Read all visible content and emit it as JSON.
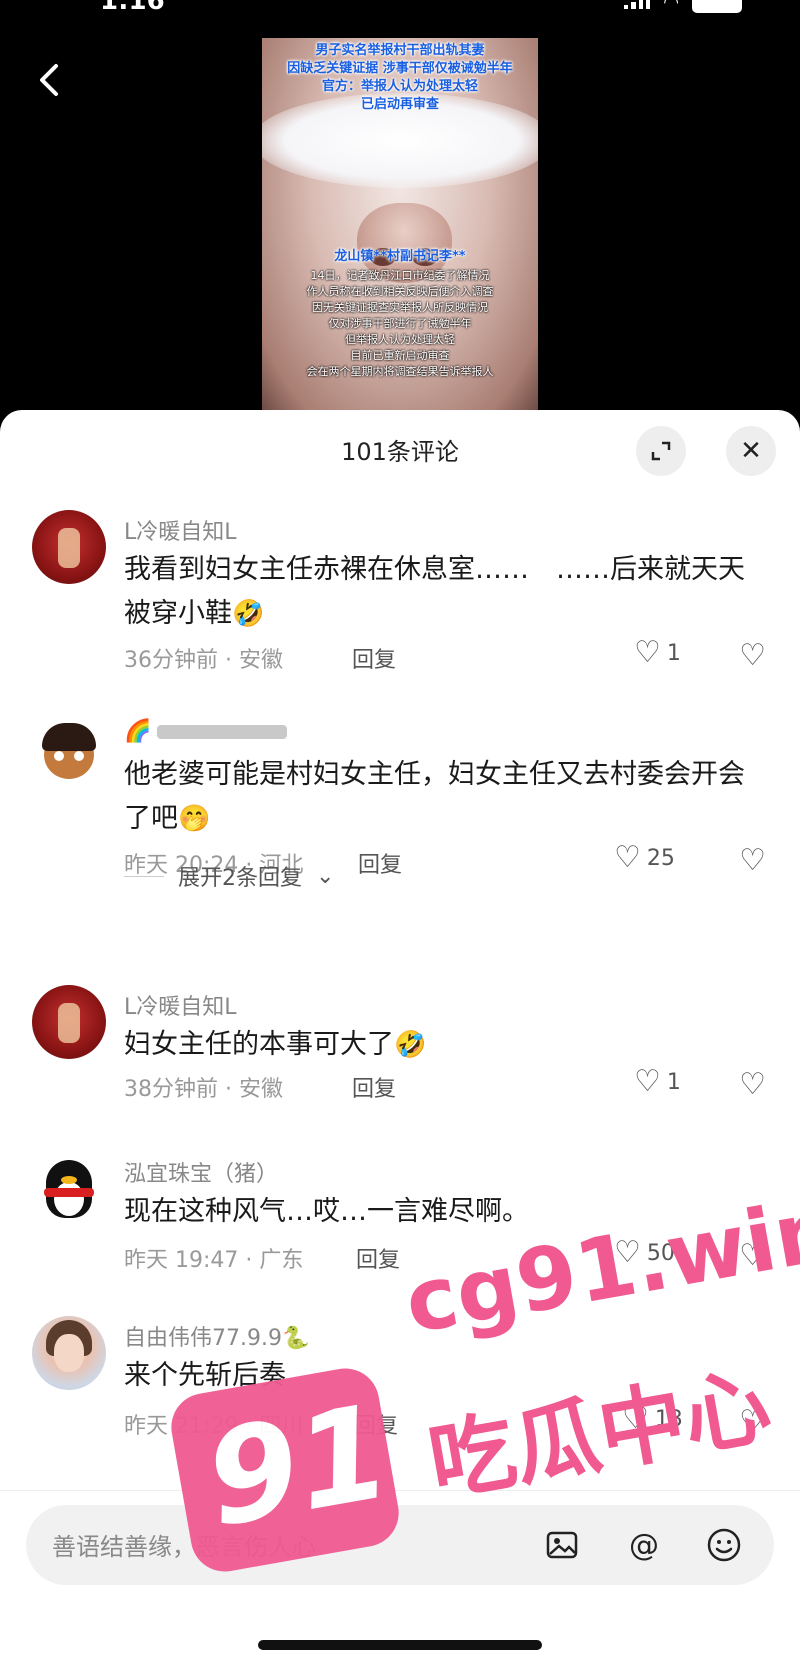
{
  "status": {
    "time": "1:16"
  },
  "video": {
    "caption_lines": [
      "男子实名举报村干部出轨其妻",
      "因缺乏关键证据 涉事干部仅被诫勉半年",
      "官方：举报人认为处理太轻",
      "已启动再审查"
    ],
    "name_label": "龙山镇**村副书记李**",
    "body_lines": [
      "14日，记者致丹江口市纪委了解情况",
      "作人员称在收到相关反映后便介入调查",
      "因无关键证据查实举报人所反映情况",
      "仅对涉事干部进行了诫勉半年",
      "但举报人认为处理太轻",
      "目前已重新启动审查",
      "会在两个星期内将调查结果告诉举报人"
    ]
  },
  "sheet": {
    "title": "101条评论",
    "expand_icon": "expand-icon",
    "close_icon": "✕"
  },
  "comments": [
    {
      "user": "L冷暖自知L",
      "text": "我看到妇女主任赤裸在休息室……　……后来就天天被穿小鞋",
      "emoji": "🤣",
      "time": "36分钟前 · 安徽",
      "reply": "回复",
      "likes": "1"
    },
    {
      "user": "🌈",
      "text": "他老婆可能是村妇女主任，妇女主任又去村委会开会了吧",
      "emoji": "🤭",
      "time": "昨天 20:24 · 河北",
      "reply": "回复",
      "likes": "25"
    },
    {
      "user": "L冷暖自知L",
      "text": "妇女主任的本事可大了",
      "emoji": "🤣",
      "time": "38分钟前 · 安徽",
      "reply": "回复",
      "likes": "1"
    },
    {
      "user": "泓宜珠宝（猪）",
      "text": "现在这种风气…哎…一言难尽啊。",
      "emoji": "",
      "time": "昨天 19:47 · 广东",
      "reply": "回复",
      "likes": "50"
    },
    {
      "user": "自由伟伟77.9.9🐍",
      "text": "来个先斩后奏",
      "emoji": "",
      "time": "昨天 21:29 · 四川",
      "reply": "回复",
      "likes": "13"
    }
  ],
  "expand_replies": "展开2条回复",
  "input": {
    "placeholder": "善语结善缘，恶言伤人心"
  },
  "watermark": {
    "badge": "91",
    "url": "cg91.win",
    "cn": "吃瓜中心"
  }
}
